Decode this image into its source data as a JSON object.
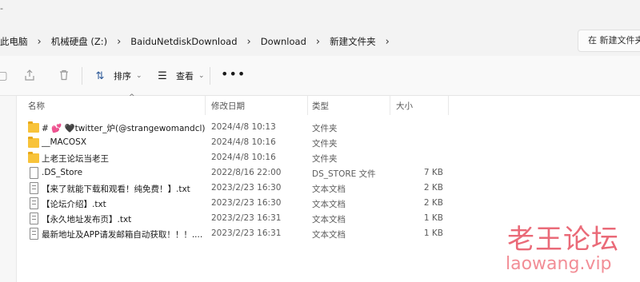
{
  "window": {
    "title_mark": "-"
  },
  "address_bar": {
    "crumbs": [
      "此电脑",
      "机械硬盘 (Z:)",
      "BaiduNetdiskDownload",
      "Download",
      "新建文件夹"
    ],
    "separator": "›",
    "search_placeholder": "在 新建文件夹"
  },
  "toolbar": {
    "sort_label": "排序",
    "view_label": "查看",
    "more_label": "•••",
    "icons": [
      "paste-icon",
      "share-icon",
      "delete-icon",
      "sort-icon",
      "view-icon",
      "more-icon"
    ]
  },
  "columns": {
    "name": "名称",
    "date": "修改日期",
    "type": "类型",
    "size": "大小"
  },
  "files": [
    {
      "kind": "folder",
      "name": "# 💕 🖤twitter_炉(@strangewomandcl)",
      "date": "2024/4/8 10:13",
      "type": "文件夹",
      "size": ""
    },
    {
      "kind": "folder",
      "name": "__MACOSX",
      "date": "2024/4/8 10:16",
      "type": "文件夹",
      "size": ""
    },
    {
      "kind": "folder",
      "name": "上老王论坛当老王",
      "date": "2024/4/8 10:16",
      "type": "文件夹",
      "size": ""
    },
    {
      "kind": "file",
      "name": ".DS_Store",
      "date": "2022/8/16 22:00",
      "type": "DS_STORE 文件",
      "size": "7 KB"
    },
    {
      "kind": "text",
      "name": "【来了就能下载和观看！纯免费！】.txt",
      "date": "2023/2/23 16:30",
      "type": "文本文档",
      "size": "2 KB"
    },
    {
      "kind": "text",
      "name": "【论坛介绍】.txt",
      "date": "2023/2/23 16:30",
      "type": "文本文档",
      "size": "2 KB"
    },
    {
      "kind": "text",
      "name": "【永久地址发布页】.txt",
      "date": "2023/2/23 16:31",
      "type": "文本文档",
      "size": "1 KB"
    },
    {
      "kind": "text",
      "name": "最新地址及APP请发邮箱自动获取！！！....",
      "date": "2023/2/23 16:31",
      "type": "文本文档",
      "size": "1 KB"
    }
  ],
  "watermark": {
    "title": "老王论坛",
    "url": "laowang.vip"
  },
  "colors": {
    "folder": "#f8c33a",
    "watermark": "#e85a6a",
    "accent": "#2b5797"
  }
}
